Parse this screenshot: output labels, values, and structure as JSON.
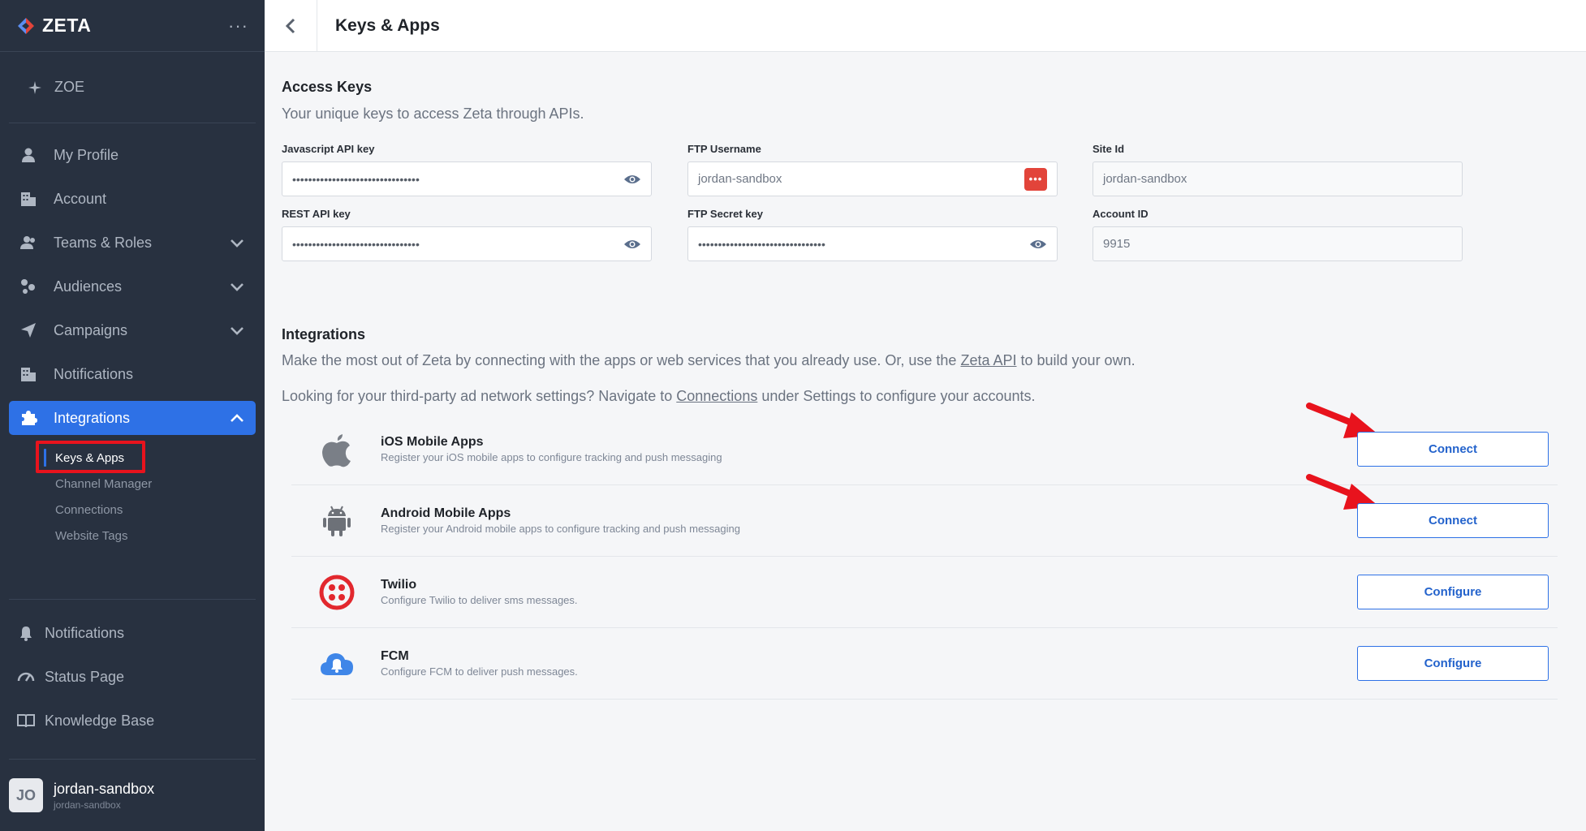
{
  "brand": {
    "name": "ZETA",
    "menu": "···"
  },
  "sidebar": {
    "zoe": "ZOE",
    "items": [
      {
        "label": "My Profile",
        "icon": "user-icon"
      },
      {
        "label": "Account",
        "icon": "building-icon"
      },
      {
        "label": "Teams & Roles",
        "icon": "team-icon"
      },
      {
        "label": "Audiences",
        "icon": "audience-icon"
      },
      {
        "label": "Campaigns",
        "icon": "paper-plane-icon"
      },
      {
        "label": "Notifications",
        "icon": "building-icon"
      },
      {
        "label": "Integrations",
        "icon": "puzzle-icon"
      }
    ],
    "sub_items": [
      "Keys & Apps",
      "Channel Manager",
      "Connections",
      "Website Tags"
    ],
    "bottom": [
      "Notifications",
      "Status Page",
      "Knowledge Base"
    ],
    "user": {
      "initials": "JO",
      "name": "jordan-sandbox",
      "sub": "jordan-sandbox"
    }
  },
  "header": {
    "title": "Keys & Apps"
  },
  "access_keys": {
    "title": "Access Keys",
    "desc": "Your unique keys to access Zeta through APIs.",
    "fields": {
      "js_key": {
        "label": "Javascript API key",
        "value": "••••••••••••••••••••••••••••••••"
      },
      "rest_key": {
        "label": "REST API key",
        "value": "••••••••••••••••••••••••••••••••"
      },
      "ftp_user": {
        "label": "FTP Username",
        "value": "jordan-sandbox",
        "badge": "•••"
      },
      "ftp_secret": {
        "label": "FTP Secret key",
        "value": "••••••••••••••••••••••••••••••••"
      },
      "site_id": {
        "label": "Site Id",
        "value": "jordan-sandbox"
      },
      "account_id": {
        "label": "Account ID",
        "value": "9915"
      }
    }
  },
  "integrations": {
    "title": "Integrations",
    "desc_pre": "Make the most out of Zeta by connecting with the apps or web services that you already use. Or, use the ",
    "desc_link": "Zeta API",
    "desc_post": " to build your own.",
    "desc2_pre": "Looking for your third-party ad network settings? Navigate to ",
    "desc2_link": "Connections",
    "desc2_post": " under Settings to configure your accounts.",
    "items": [
      {
        "name": "iOS Mobile Apps",
        "desc": "Register your iOS mobile apps to configure tracking and push messaging",
        "button": "Connect"
      },
      {
        "name": "Android Mobile Apps",
        "desc": "Register your Android mobile apps to configure tracking and push messaging",
        "button": "Connect"
      },
      {
        "name": "Twilio",
        "desc": "Configure Twilio to deliver sms messages.",
        "button": "Configure"
      },
      {
        "name": "FCM",
        "desc": "Configure FCM to deliver push messages.",
        "button": "Configure"
      }
    ]
  },
  "colors": {
    "sidebar": "#283140",
    "accent": "#2e71e6",
    "annotation": "#e8131d"
  }
}
